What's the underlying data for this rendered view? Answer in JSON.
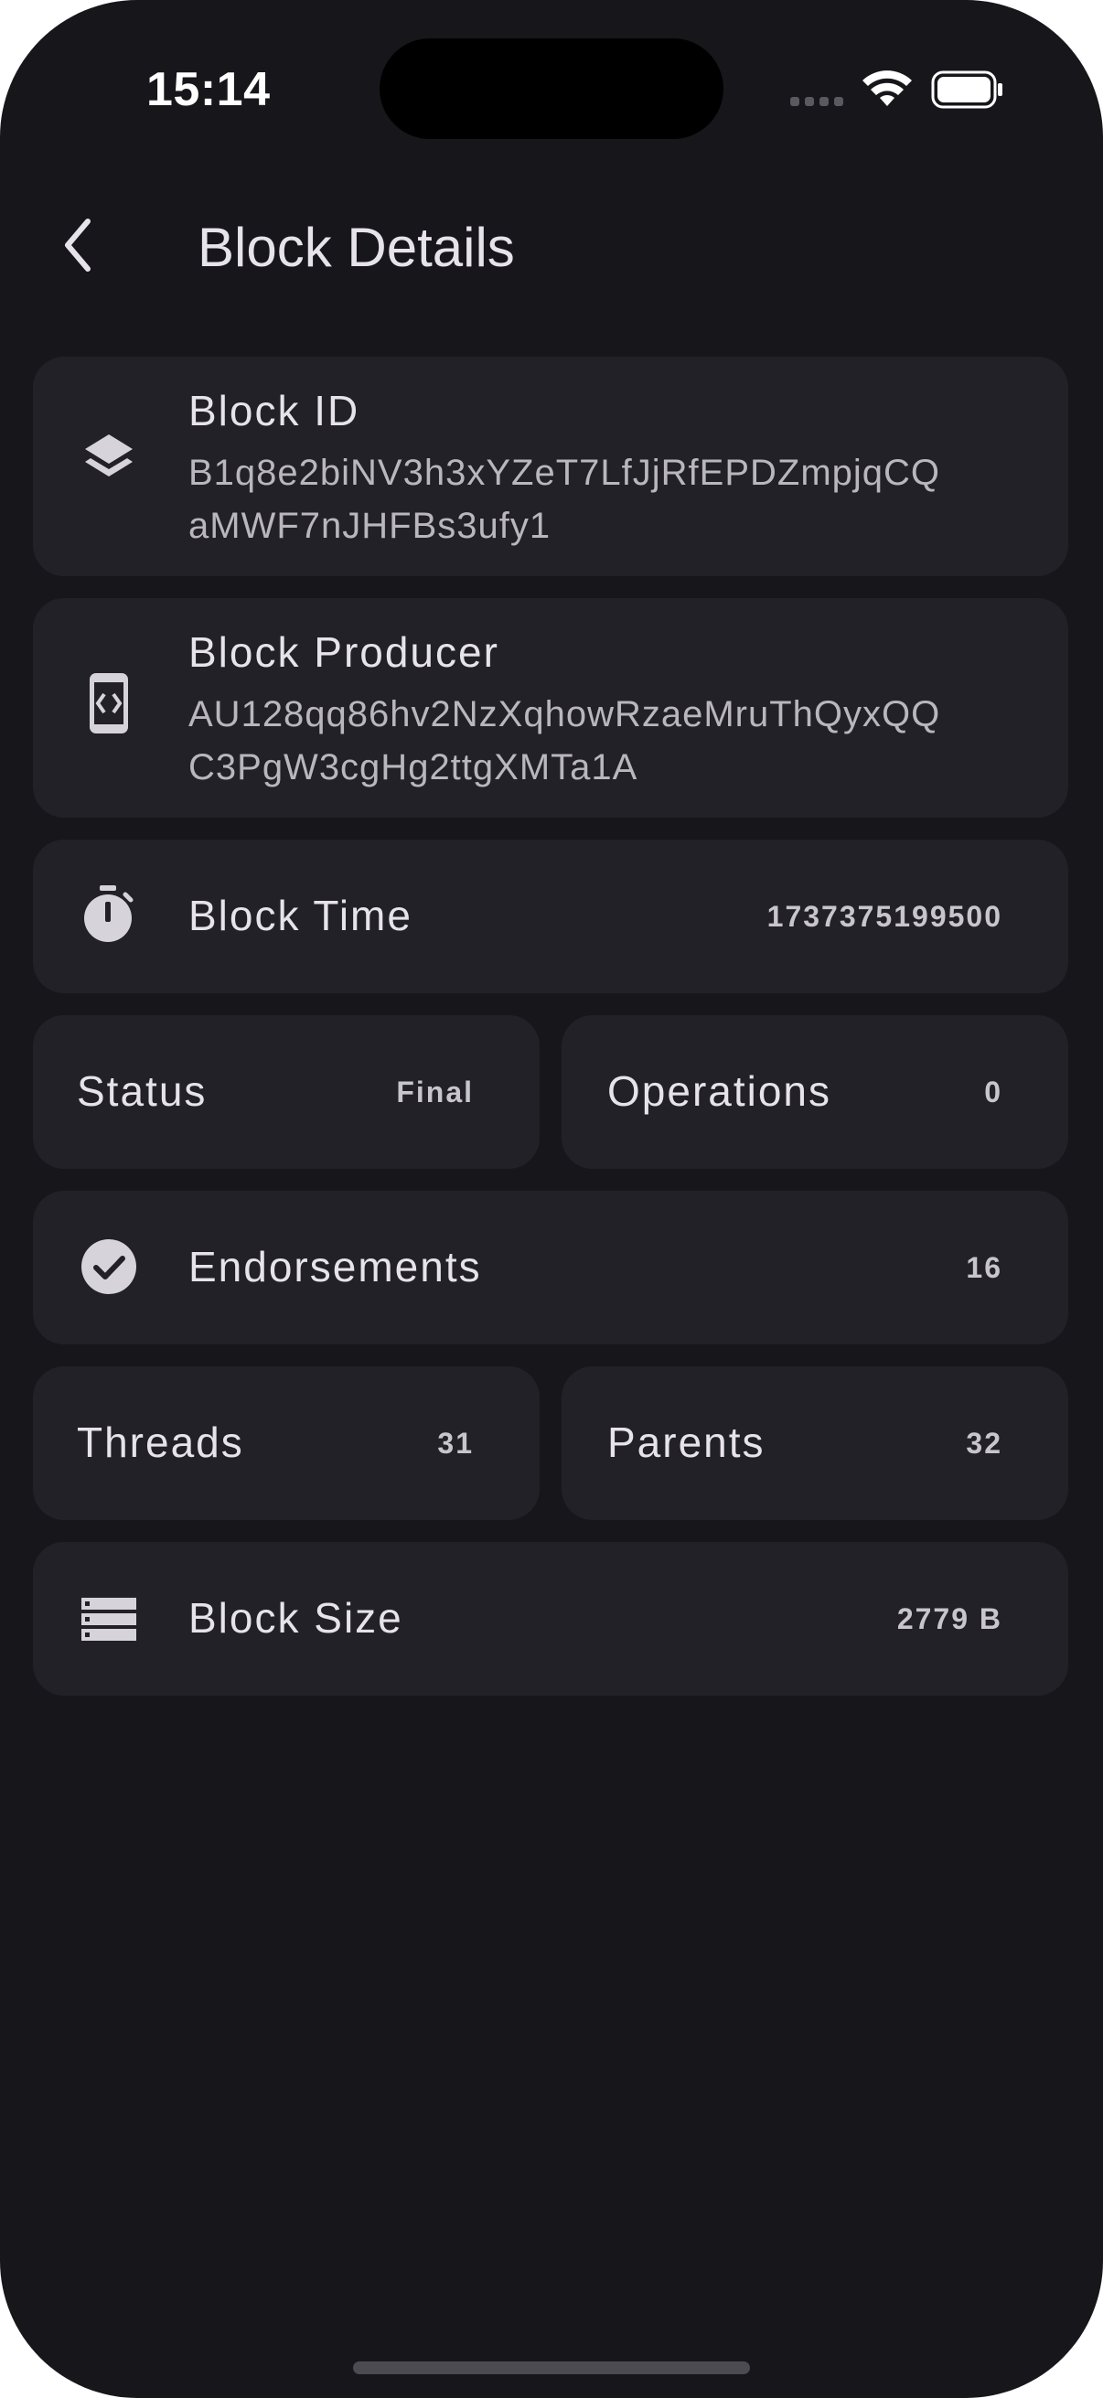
{
  "status_bar": {
    "time": "15:14"
  },
  "header": {
    "title": "Block Details",
    "back_icon": "chevron-left-icon"
  },
  "block_id": {
    "label": "Block ID",
    "value_line1": "B1q8e2biNV3h3xYZeT7LfJjRfEPDZmpjqCQ",
    "value_line2": "aMWF7nJHFBs3ufy1",
    "icon": "layers-icon"
  },
  "block_producer": {
    "label": "Block Producer",
    "value_line1": "AU128qq86hv2NzXqhowRzaeMruThQyxQQ",
    "value_line2": "C3PgW3cgHg2ttgXMTa1A",
    "icon": "code-device-icon"
  },
  "block_time": {
    "label": "Block Time",
    "value": "1737375199500",
    "icon": "stopwatch-icon"
  },
  "status": {
    "label": "Status",
    "value": "Final"
  },
  "operations": {
    "label": "Operations",
    "value": "0"
  },
  "endorsements": {
    "label": "Endorsements",
    "value": "16",
    "icon": "check-circle-icon"
  },
  "threads": {
    "label": "Threads",
    "value": "31"
  },
  "parents": {
    "label": "Parents",
    "value": "32"
  },
  "block_size": {
    "label": "Block Size",
    "value": "2779 B",
    "icon": "storage-icon"
  },
  "colors": {
    "background": "#17161b",
    "card": "#222127",
    "text_primary": "#e6e3ea",
    "text_secondary": "#b9b6be"
  }
}
